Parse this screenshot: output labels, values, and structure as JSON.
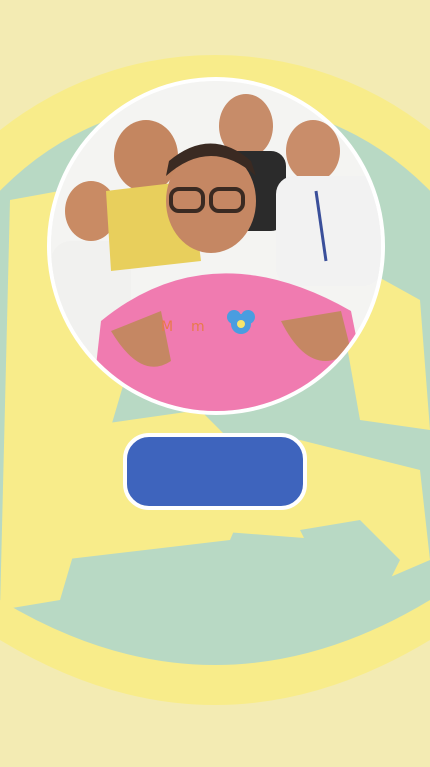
{
  "background": {
    "base_color": "#f3ebb3",
    "ring_color": "#f8ec8a",
    "teal_color": "#b8d9c4"
  },
  "profile": {
    "image_alt": "profile-photo",
    "border_color": "#ffffff"
  },
  "action_button": {
    "label": "",
    "color": "#3e64bd"
  }
}
